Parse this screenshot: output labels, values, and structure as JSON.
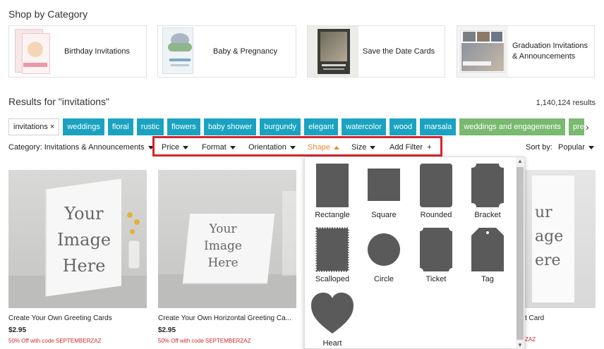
{
  "shop_title": "Shop by Category",
  "categories": [
    {
      "label": "Birthday Invitations"
    },
    {
      "label": "Baby & Pregnancy"
    },
    {
      "label": "Save the Date Cards"
    },
    {
      "label": "Graduation Invitations & Announcements"
    }
  ],
  "results_title": "Results for \"invitations\"",
  "results_count": "1,140,124 results",
  "chips": {
    "active": "invitations",
    "close": "×",
    "items": [
      "weddings",
      "floral",
      "rustic",
      "flowers",
      "baby shower",
      "burgundy",
      "elegant",
      "watercolor",
      "wood",
      "marsala"
    ],
    "green_items": [
      "weddings and engagements",
      "preg"
    ],
    "next": "›"
  },
  "filters": {
    "category": "Category: Invitations & Announcements",
    "price": "Price",
    "format": "Format",
    "orientation": "Orientation",
    "shape": "Shape",
    "size": "Size",
    "add_filter": "Add Filter",
    "add_plus": "+",
    "sort_label": "Sort by:",
    "sort_value": "Popular"
  },
  "products": [
    {
      "name": "Create Your Own Greeting Cards",
      "price": "$2.95",
      "promo": "50% Off with code SEPTEMBERZAZ",
      "img_text": "Your Image Here"
    },
    {
      "name": "Create Your Own Horizontal Greeting Ca...",
      "price": "$2.95",
      "promo": "50% Off with code SEPTEMBERZAZ",
      "img_text": "Your Image Here"
    },
    {
      "name": "t Card",
      "price": "",
      "promo": "ZAZ",
      "img_text": "ur age ere"
    }
  ],
  "shapes": [
    {
      "label": "Rectangle",
      "icon": "rectangle-icon"
    },
    {
      "label": "Square",
      "icon": "square-icon"
    },
    {
      "label": "Rounded",
      "icon": "rounded-icon"
    },
    {
      "label": "Bracket",
      "icon": "bracket-icon"
    },
    {
      "label": "Scalloped",
      "icon": "scalloped-icon"
    },
    {
      "label": "Circle",
      "icon": "circle-icon"
    },
    {
      "label": "Ticket",
      "icon": "ticket-icon"
    },
    {
      "label": "Tag",
      "icon": "tag-icon"
    },
    {
      "label": "Heart",
      "icon": "heart-icon"
    }
  ],
  "colors": {
    "accent": "#1aa3c1",
    "green": "#7ab970",
    "active_filter": "#e78b2f",
    "highlight": "#d6252c",
    "shape": "#5a5a5a"
  }
}
